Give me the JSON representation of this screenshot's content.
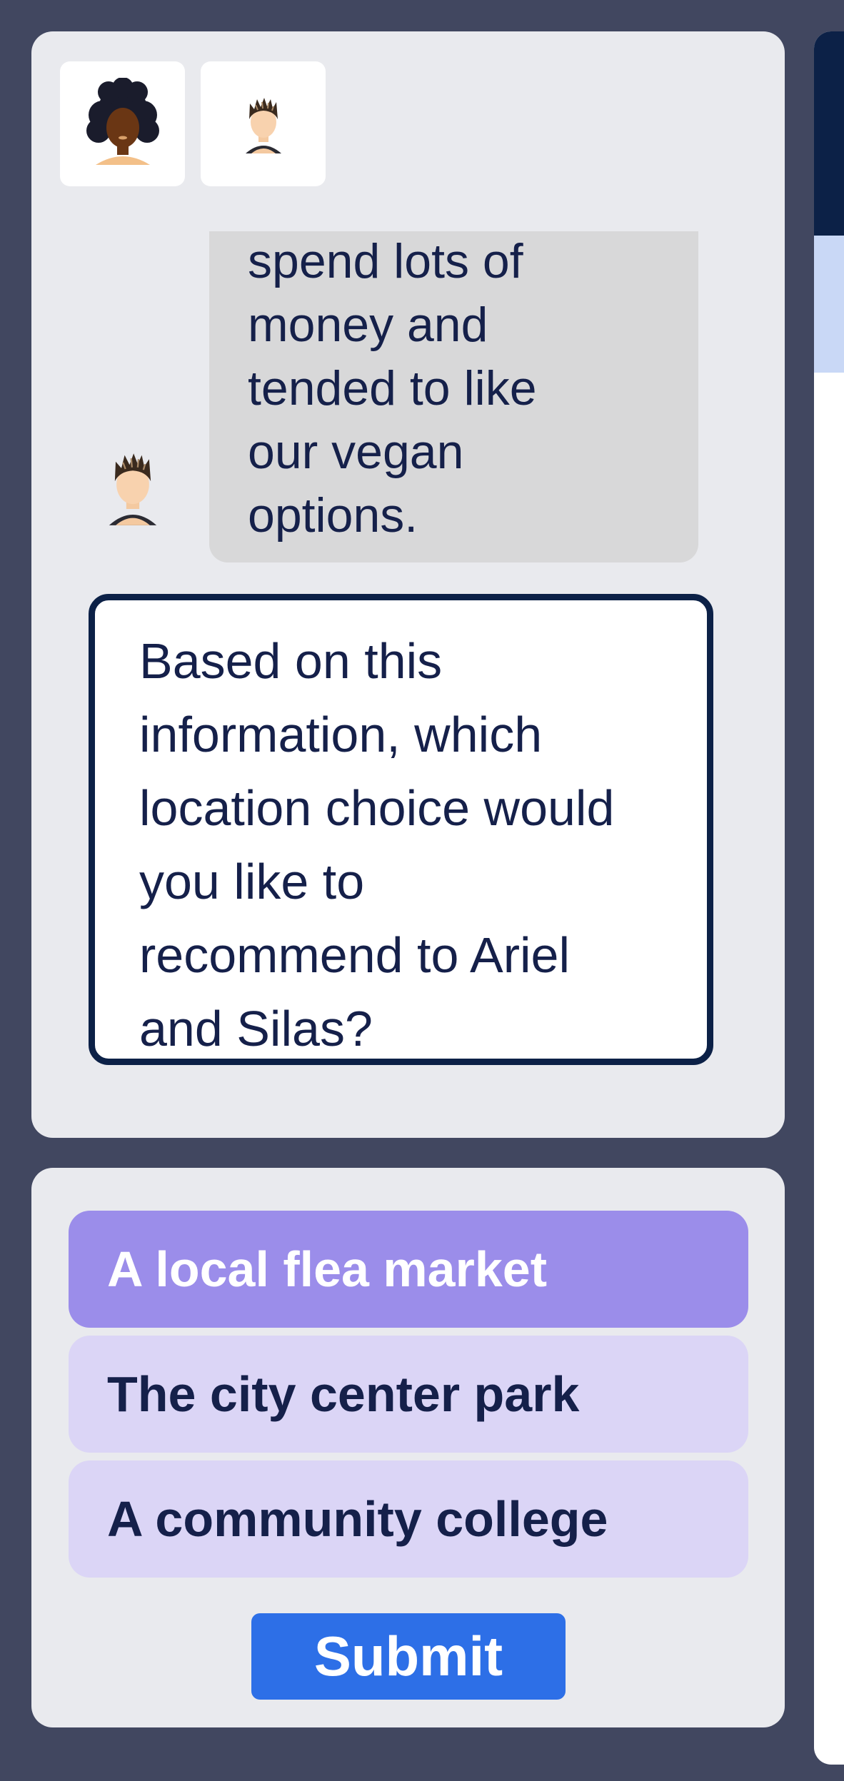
{
  "participants": [
    {
      "name": "Ariel",
      "avatar": "woman-curly-hair-avatar"
    },
    {
      "name": "Silas",
      "avatar": "man-spiky-hair-avatar"
    }
  ],
  "chat": {
    "message_lines": [
      "spend lots of",
      "money and",
      "tended to like",
      "our vegan",
      "options."
    ],
    "speaker_avatar": "man-spiky-hair-avatar"
  },
  "question": {
    "lines": [
      "Based on this",
      "information, which",
      "location choice would",
      "you like to",
      "recommend to Ariel",
      "and Silas?"
    ]
  },
  "options": [
    {
      "label": "A local flea market",
      "selected": true
    },
    {
      "label": "The city center park",
      "selected": false
    },
    {
      "label": "A community college",
      "selected": false
    }
  ],
  "submit_label": "Submit",
  "colors": {
    "background": "#414760",
    "card": "#e9eaee",
    "navy": "#0c2147",
    "option_selected": "#9b8dea",
    "option_unselected": "#dbd5f6",
    "submit": "#2d6fe7"
  }
}
